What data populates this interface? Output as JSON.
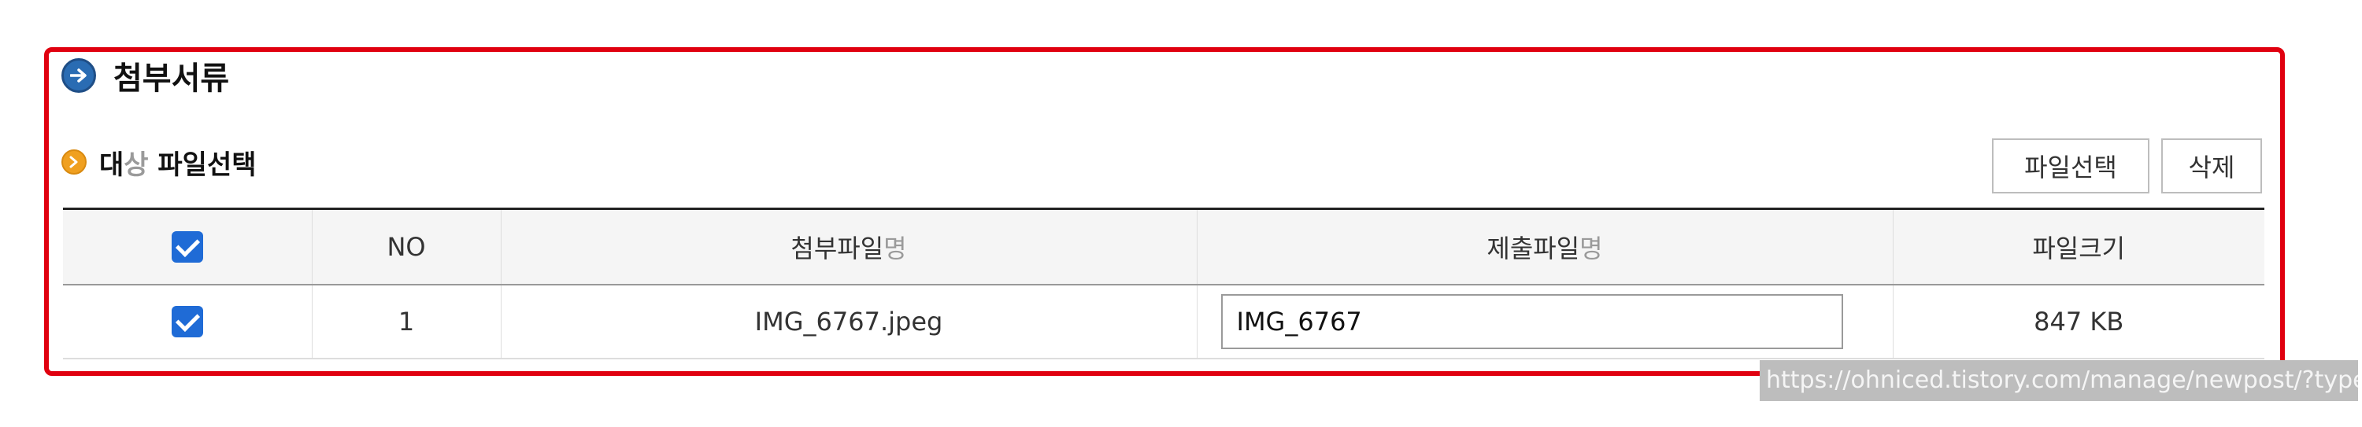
{
  "section": {
    "title": "첨부서류",
    "icon": "arrow-right-circle-icon"
  },
  "subsection": {
    "title_part1": "대",
    "title_part2_dim": "상",
    "title_part3": " 파일선택",
    "icon": "chevron-right-circle-icon"
  },
  "buttons": {
    "select_file": "파일선택",
    "delete": "삭제"
  },
  "table": {
    "headers": {
      "no": "NO",
      "attach_name_part1": "첨부파일",
      "attach_name_part2_dim": "명",
      "submit_name_part1": "제출파일",
      "submit_name_part2_dim": "명",
      "size": "파일크기"
    },
    "header_checked": true,
    "rows": [
      {
        "checked": true,
        "no": "1",
        "attach_name": "IMG_6767.jpeg",
        "submit_name": "IMG_6767",
        "size": "847 KB"
      }
    ]
  },
  "status_url": "https://ohniced.tistory.com/manage/newpost/?type=p",
  "colors": {
    "frame_border": "#e0000f",
    "checkbox": "#1f6bd6",
    "section_icon": "#2a6cb3",
    "sub_icon": "#f0a020"
  }
}
